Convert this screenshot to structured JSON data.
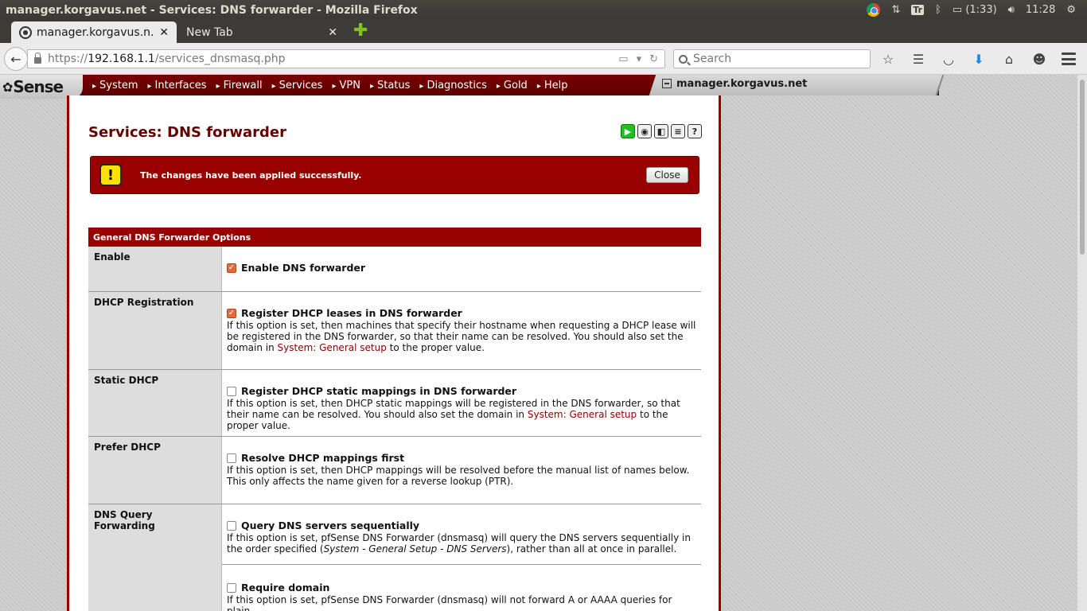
{
  "os": {
    "window_title": "manager.korgavus.net - Services: DNS forwarder - Mozilla Firefox",
    "tray": {
      "battery": "(1:33)",
      "clock": "11:28",
      "tr_badge": "Tr"
    }
  },
  "browser": {
    "tabs": [
      {
        "label": "manager.korgavus.n...",
        "close": "✕"
      },
      {
        "label": "New Tab",
        "close": "✕"
      }
    ],
    "new_tab": "✚",
    "url_prefix": "https://",
    "url_host": "192.168.1.1",
    "url_path": "/services_dnsmasq.php",
    "search_placeholder": "Search"
  },
  "pfsense": {
    "logo": "Sense",
    "menu": [
      "System",
      "Interfaces",
      "Firewall",
      "Services",
      "VPN",
      "Status",
      "Diagnostics",
      "Gold",
      "Help"
    ],
    "hostname": "manager.korgavus.net"
  },
  "page": {
    "title": "Services: DNS forwarder",
    "alert": {
      "text": "The changes have been applied successfully.",
      "close_label": "Close"
    },
    "section_header": "General DNS Forwarder Options",
    "rows": [
      {
        "label": "Enable",
        "checked": true,
        "title": "Enable DNS forwarder",
        "desc": ""
      },
      {
        "label": "DHCP Registration",
        "checked": true,
        "title": "Register DHCP leases in DNS forwarder",
        "desc": "If this option is set, then machines that specify their hostname when requesting a DHCP lease will be registered in the DNS forwarder, so that their name can be resolved. You should also set the domain in",
        "link": "System: General setup",
        "desc_end": "to the proper value."
      },
      {
        "label": "Static DHCP",
        "checked": false,
        "title": "Register DHCP static mappings in DNS forwarder",
        "desc": "If this option is set, then DHCP static mappings will be registered in the DNS forwarder, so that their name can be resolved. You should also set the domain in",
        "link": "System: General setup",
        "desc_end": "to the proper value."
      },
      {
        "label": "Prefer DHCP",
        "checked": false,
        "title": "Resolve DHCP mappings first",
        "desc": "If this option is set, then DHCP mappings will be resolved before the manual list of names below. This only affects the name given for a reverse lookup (PTR)."
      },
      {
        "label": "DNS Query Forwarding",
        "checked": false,
        "title": "Query DNS servers sequentially",
        "desc": "If this option is set, pfSense DNS Forwarder (dnsmasq) will query the DNS servers sequentially in the order specified (",
        "desc_em": "System - General Setup - DNS Servers",
        "desc_end": "), rather than all at once in parallel.",
        "sub_title": "Require domain",
        "sub_desc": "If this option is set, pfSense DNS Forwarder (dnsmasq) will not forward A or AAAA queries for plain"
      }
    ]
  },
  "colors": {
    "accent": "#990000",
    "title": "#660000",
    "checkbox_on": "#e56a3a"
  }
}
